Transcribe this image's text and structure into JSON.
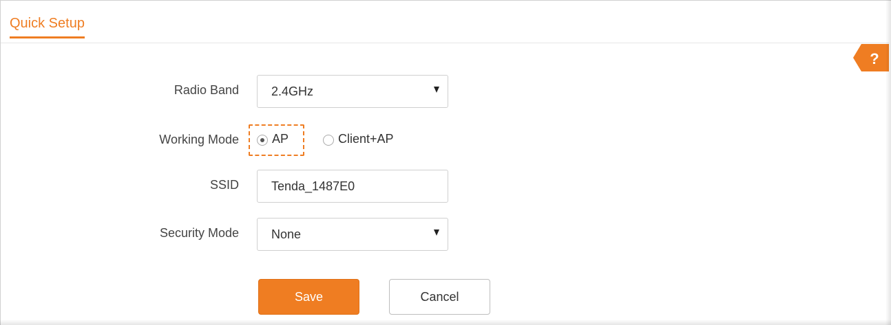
{
  "header": {
    "title": "Quick Setup"
  },
  "help": {
    "label": "?",
    "icon": "help-icon"
  },
  "form": {
    "radio_band": {
      "label": "Radio Band",
      "value": "2.4GHz"
    },
    "working_mode": {
      "label": "Working Mode",
      "options": [
        {
          "label": "AP",
          "selected": true
        },
        {
          "label": "Client+AP",
          "selected": false
        }
      ]
    },
    "ssid": {
      "label": "SSID",
      "value": "Tenda_1487E0"
    },
    "security_mode": {
      "label": "Security Mode",
      "value": "None"
    }
  },
  "actions": {
    "save_label": "Save",
    "cancel_label": "Cancel"
  },
  "colors": {
    "accent": "#ef7d22",
    "border": "#cfcfcf"
  }
}
